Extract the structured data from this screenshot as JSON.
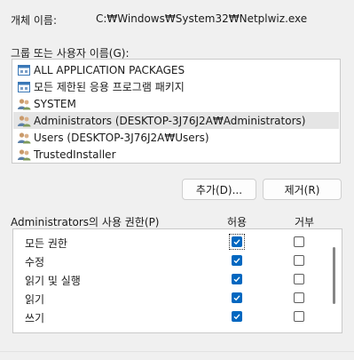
{
  "object": {
    "label": "개체 이름:",
    "value": "C:₩Windows₩System32₩Netplwiz.exe"
  },
  "group_list": {
    "label": "그룹 또는 사용자 이름(G):",
    "items": [
      {
        "label": "ALL APPLICATION PACKAGES",
        "icon": "package-group-icon"
      },
      {
        "label": "모든 제한된 응용 프로그램 패키지",
        "icon": "package-group-icon"
      },
      {
        "label": "SYSTEM",
        "icon": "users-icon"
      },
      {
        "label": "Administrators (DESKTOP-3J76J2A₩Administrators)",
        "icon": "users-icon",
        "selected": true
      },
      {
        "label": "Users (DESKTOP-3J76J2A₩Users)",
        "icon": "users-icon"
      },
      {
        "label": "TrustedInstaller",
        "icon": "users-icon"
      }
    ]
  },
  "buttons": {
    "add": "추가(D)...",
    "remove": "제거(R)"
  },
  "permissions": {
    "title": "Administrators의 사용 권한(P)",
    "allow_header": "허용",
    "deny_header": "거부",
    "rows": [
      {
        "label": "모든 권한",
        "allow": true,
        "deny": false
      },
      {
        "label": "수정",
        "allow": true,
        "deny": false
      },
      {
        "label": "읽기 및 실행",
        "allow": true,
        "deny": false
      },
      {
        "label": "읽기",
        "allow": true,
        "deny": false
      },
      {
        "label": "쓰기",
        "allow": true,
        "deny": false
      }
    ]
  },
  "colors": {
    "accent": "#0067c0",
    "selection": "#e5e5e5"
  }
}
